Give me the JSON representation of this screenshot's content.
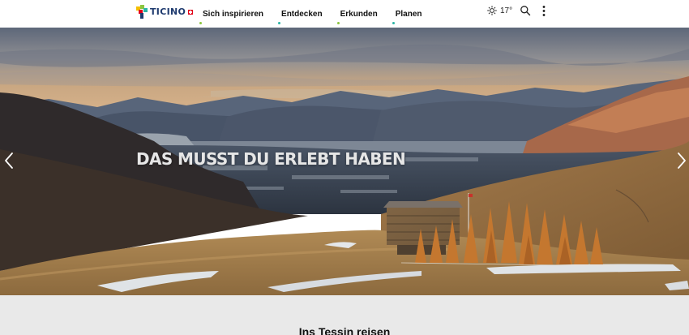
{
  "header": {
    "logo_text": "TICINO",
    "nav": [
      {
        "label": "Sich inspirieren",
        "dot_color": "#8cc63f"
      },
      {
        "label": "Entdecken",
        "dot_color": "#2bb5a6"
      },
      {
        "label": "Erkunden",
        "dot_color": "#8cc63f"
      },
      {
        "label": "Planen",
        "dot_color": "#2bb5a6"
      }
    ],
    "weather": {
      "icon": "sun-icon",
      "temperature": "17°"
    },
    "search_icon": "search-icon",
    "more_icon": "more-vertical-icon"
  },
  "hero": {
    "title": "DAS MUSST DU ERLEBT HABEN",
    "prev_icon": "chevron-left-icon",
    "next_icon": "chevron-right-icon"
  },
  "section": {
    "title": "Ins Tessin reisen"
  },
  "colors": {
    "brand_navy": "#1e3a6e",
    "brand_red": "#e2001a",
    "section_background": "#e9e9e9"
  }
}
